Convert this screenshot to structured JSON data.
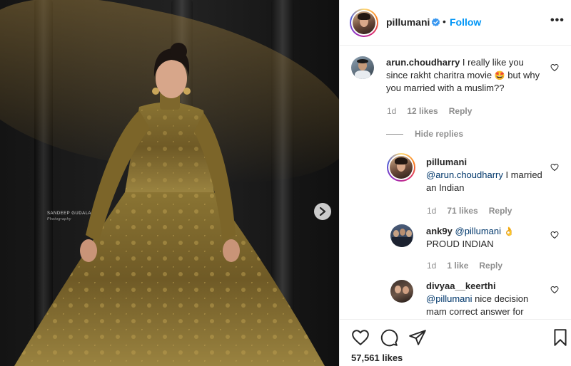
{
  "post": {
    "watermark_name": "SANDEEP GUDALA",
    "watermark_sub": "Photography",
    "next_icon": "chevron-right-icon"
  },
  "header": {
    "username": "pillumani",
    "separator": "•",
    "follow_label": "Follow",
    "more_label": "•••"
  },
  "comments": [
    {
      "username": "arun.choudharry",
      "text_before_emoji": " I really like you since rakht charitra movie ",
      "emoji": "🤩",
      "text_after_emoji": " but why you married with a muslim??",
      "age": "1d",
      "likes": "12 likes",
      "reply_label": "Reply"
    }
  ],
  "hide_replies_label": "Hide replies",
  "replies": [
    {
      "username": "pillumani",
      "mention": "@arun.choudharry",
      "text": " I married an Indian",
      "age": "1d",
      "likes": "71 likes",
      "reply_label": "Reply"
    },
    {
      "username": "ank9y",
      "mention": "@pillumani",
      "emoji": "👌",
      "text": "PROUD INDIAN",
      "age": "1d",
      "likes": "1 like",
      "reply_label": "Reply"
    },
    {
      "username": "divyaa__keerthi",
      "mention": "@pillumani",
      "text": " nice decision mam correct answer for"
    }
  ],
  "footer": {
    "likes": "57,561 likes"
  },
  "colors": {
    "link_blue": "#0095f6",
    "mention_blue": "#00376b",
    "meta_gray": "#8e8e8e",
    "gold": "#8a7433"
  }
}
